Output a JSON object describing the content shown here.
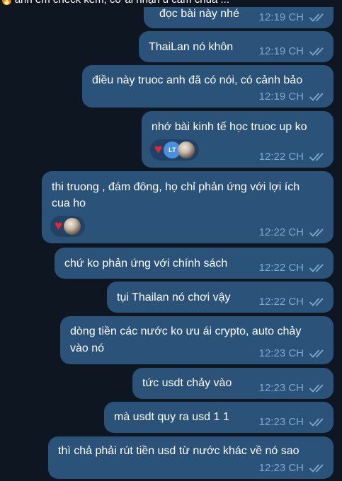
{
  "top_preview": {
    "text": "anh em check kèm, cơ ai nhận ủ cảm chủa ..."
  },
  "messages": [
    {
      "text": "đọc bài này nhé",
      "time": "12:19 CH"
    },
    {
      "text": "ThaiLan nó khôn",
      "time": "12:19 CH"
    },
    {
      "text": "điều này truoc anh đã có nói, có cảnh bảo",
      "time": "12:19 CH"
    },
    {
      "text": "nhớ bài kinh tế học truoc up ko",
      "time": "12:22 CH",
      "reaction": {
        "emoji": "♥",
        "avatar_initials": "LT"
      }
    },
    {
      "line1": "thi truong , đám đông, họ chỉ phản ứng với lợi ích",
      "line2": "cua ho",
      "time": "12:22 CH",
      "reaction": {
        "emoji": "♥"
      }
    },
    {
      "text": "chứ ko phản ứng với chính sách",
      "time": "12:22 CH"
    },
    {
      "text": "tụi Thailan nó chơi vậy",
      "time": "12:22 CH"
    },
    {
      "line1": "dòng tiền các nước ko ưu ái crypto, auto chảy",
      "line2": "vào nó",
      "time": "12:23 CH"
    },
    {
      "text": "tức usdt chảy vào",
      "time": "12:23 CH"
    },
    {
      "text": "mà usdt quy ra usd 1 1",
      "time": "12:23 CH"
    },
    {
      "text": "thì chả phải rút tiền usd từ nước khác về nó sao",
      "time": "12:23 CH"
    }
  ],
  "colors": {
    "background": "#0e1621",
    "bubble_outgoing": "#2b5278",
    "meta_text": "#7da8d3",
    "heart": "#e8243a"
  },
  "icons": [
    "fire-emoji-icon",
    "double-check-icon",
    "heart-reaction-icon"
  ]
}
